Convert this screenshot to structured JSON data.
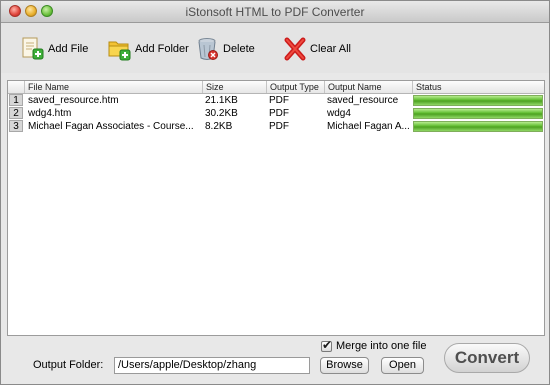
{
  "window": {
    "title": "iStonsoft HTML to PDF Converter"
  },
  "toolbar": {
    "add_file": {
      "label": "Add File",
      "icon": "add-file-icon"
    },
    "add_folder": {
      "label": "Add Folder",
      "icon": "add-folder-icon"
    },
    "delete": {
      "label": "Delete",
      "icon": "trash-icon"
    },
    "clear_all": {
      "label": "Clear All",
      "icon": "red-x-icon"
    }
  },
  "table": {
    "columns": [
      "File Name",
      "Size",
      "Output Type",
      "Output Name",
      "Status"
    ],
    "rows": [
      {
        "num": "1",
        "file_name": "saved_resource.htm",
        "size": "21.1KB",
        "output_type": "PDF",
        "output_name": "saved_resource",
        "progress": 1.0
      },
      {
        "num": "2",
        "file_name": "wdg4.htm",
        "size": "30.2KB",
        "output_type": "PDF",
        "output_name": "wdg4",
        "progress": 1.0
      },
      {
        "num": "3",
        "file_name": "Michael Fagan Associates - Course...",
        "size": "8.2KB",
        "output_type": "PDF",
        "output_name": "Michael Fagan A...",
        "progress": 1.0
      }
    ]
  },
  "bottom": {
    "merge_label": "Merge into one file",
    "merge_checked": true,
    "output_folder_label": "Output Folder:",
    "output_folder_value": "/Users/apple/Desktop/zhang",
    "browse_label": "Browse",
    "open_label": "Open",
    "convert_label": "Convert"
  },
  "colors": {
    "progress_green": "#5fbc2f",
    "delete_red": "#cc1b1b"
  }
}
